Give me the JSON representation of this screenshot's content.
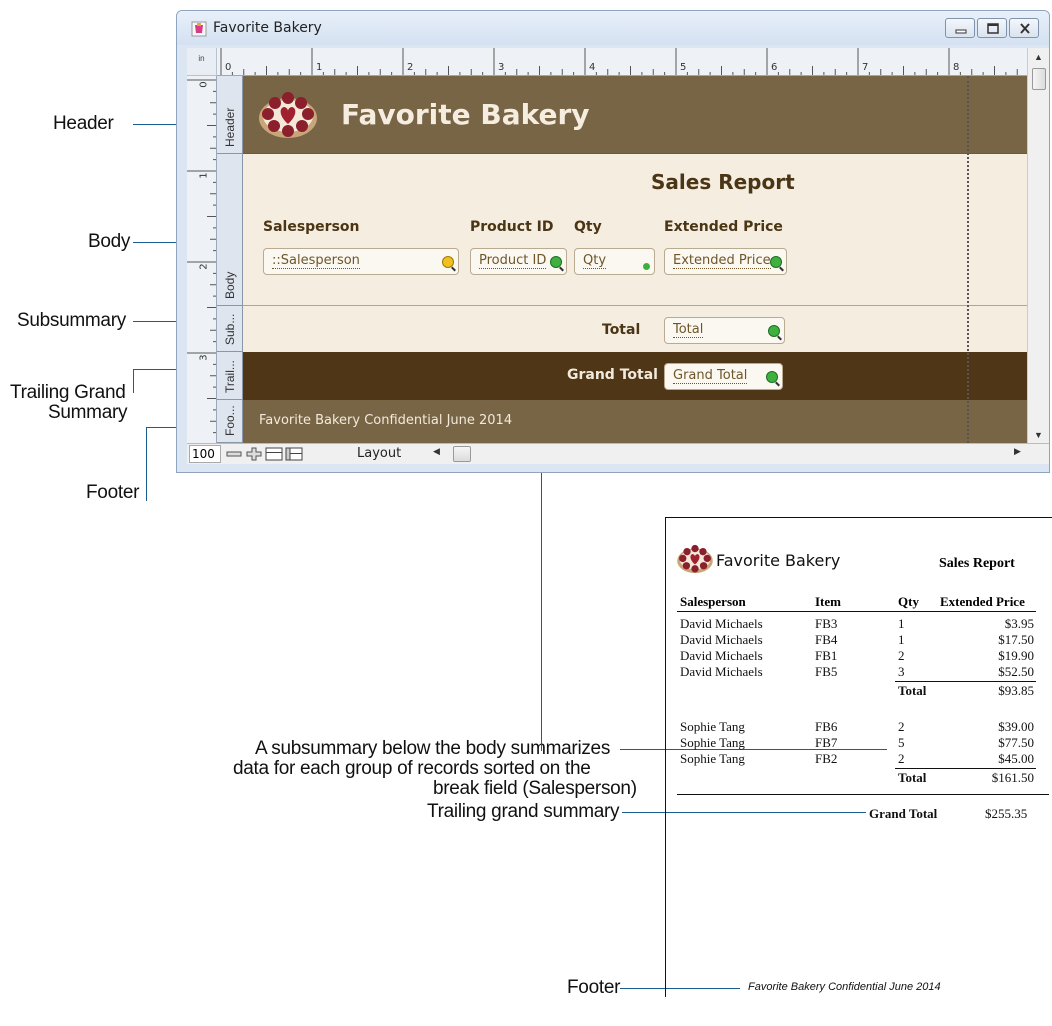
{
  "callouts": {
    "header": "Header",
    "body": "Body",
    "subsummary": "Subsummary",
    "trailing_grand_line1": "Trailing Grand",
    "trailing_grand_line2": "Summary",
    "footer": "Footer",
    "subsummary_desc_line1": "A subsummary below the body summarizes",
    "subsummary_desc_line2": "data for each group of records sorted on the",
    "subsummary_desc_line3": "break field (Salesperson)",
    "trailing_grand_summary": "Trailing grand summary",
    "footer_bottom": "Footer"
  },
  "window": {
    "title": "Favorite Bakery",
    "ruler_unit": "in",
    "h_ruler_numbers": [
      "0",
      "1",
      "2",
      "3",
      "4",
      "5",
      "6",
      "7",
      "8"
    ],
    "v_ruler_numbers": [
      "0",
      "1",
      "2",
      "3"
    ],
    "parts": {
      "header": "Header",
      "body": "Body",
      "subsummary": "Sub...",
      "trailing": "Trail...",
      "footer": "Foo..."
    },
    "header_title": "Favorite Bakery",
    "report_title": "Sales Report",
    "labels": {
      "salesperson": "Salesperson",
      "product_id": "Product ID",
      "qty": "Qty",
      "extended_price": "Extended Price",
      "total": "Total",
      "grand_total": "Grand Total"
    },
    "fields": {
      "salesperson": "::Salesperson",
      "product_id": "Product ID",
      "qty": "Qty",
      "extended_price": "Extended Price",
      "total": "Total",
      "grand_total": "Grand Total"
    },
    "footer_text": "Favorite Bakery Confidential June 2014",
    "zoom": "100",
    "mode": "Layout"
  },
  "report": {
    "title": "Favorite Bakery",
    "subtitle": "Sales Report",
    "columns": [
      "Salesperson",
      "Item",
      "Qty",
      "Extended Price"
    ],
    "group1": [
      [
        "David Michaels",
        "FB3",
        "1",
        "$3.95"
      ],
      [
        "David Michaels",
        "FB4",
        "1",
        "$17.50"
      ],
      [
        "David Michaels",
        "FB1",
        "2",
        "$19.90"
      ],
      [
        "David Michaels",
        "FB5",
        "3",
        "$52.50"
      ]
    ],
    "group1_total_label": "Total",
    "group1_total": "$93.85",
    "group2": [
      [
        "Sophie Tang",
        "FB6",
        "2",
        "$39.00"
      ],
      [
        "Sophie Tang",
        "FB7",
        "5",
        "$77.50"
      ],
      [
        "Sophie Tang",
        "FB2",
        "2",
        "$45.00"
      ]
    ],
    "group2_total_label": "Total",
    "group2_total": "$161.50",
    "grand_total_label": "Grand Total",
    "grand_total": "$255.35",
    "footer": "Favorite Bakery Confidential June 2014"
  },
  "colors": {
    "header_bg": "#786546",
    "body_bg": "#f5ede0",
    "grand_bg": "#4e3617",
    "callout_line": "#1a5d8e"
  }
}
